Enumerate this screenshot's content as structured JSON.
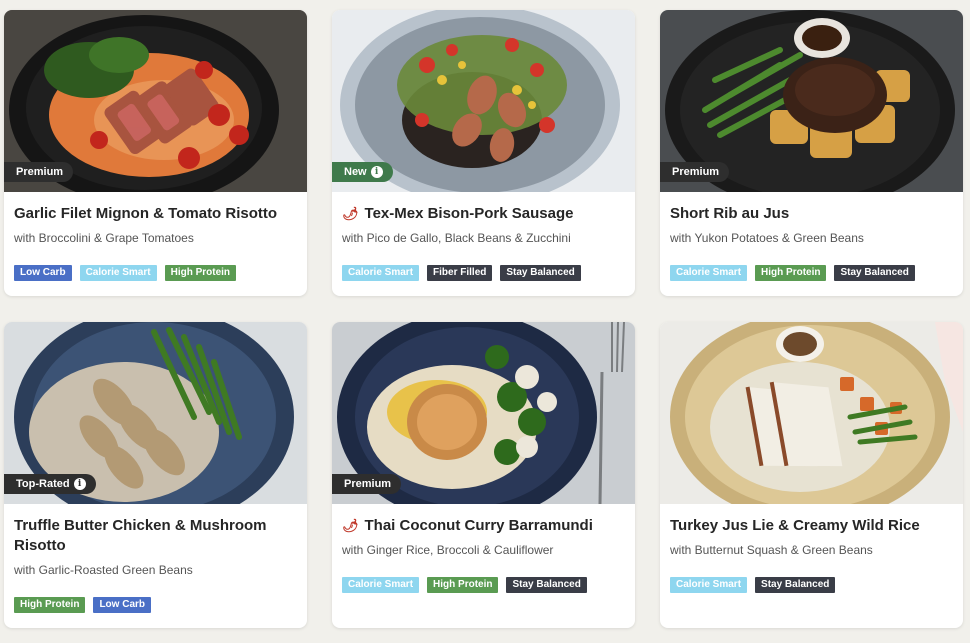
{
  "tag_colors": {
    "Low Carb": "#4a6fc6",
    "Calorie Smart": "#8ed6ef",
    "High Protein": "#5a9b52",
    "Fiber Filled": "#3a3d47",
    "Stay Balanced": "#3a3d47"
  },
  "cards": [
    {
      "badge": "Premium",
      "badge_style": "dark",
      "badge_info": false,
      "spicy": false,
      "title": "Garlic Filet Mignon & Tomato Risotto",
      "subtitle": "with Broccolini & Grape Tomatoes",
      "tags": [
        "Low Carb",
        "Calorie Smart",
        "High Protein"
      ],
      "photo": "dark-bowl-steak-risotto"
    },
    {
      "badge": "New",
      "badge_style": "green",
      "badge_info": true,
      "spicy": true,
      "title": "Tex-Mex Bison-Pork Sausage",
      "subtitle": "with Pico de Gallo, Black Beans & Zucchini",
      "tags": [
        "Calorie Smart",
        "Fiber Filled",
        "Stay Balanced"
      ],
      "photo": "grey-plate-sausage-beans"
    },
    {
      "badge": "Premium",
      "badge_style": "dark",
      "badge_info": false,
      "spicy": false,
      "title": "Short Rib au Jus",
      "subtitle": "with Yukon Potatoes & Green Beans",
      "tags": [
        "Calorie Smart",
        "High Protein",
        "Stay Balanced"
      ],
      "photo": "black-plate-short-rib"
    },
    {
      "badge": "Top-Rated",
      "badge_style": "dark",
      "badge_info": true,
      "spicy": false,
      "title": "Truffle Butter Chicken & Mushroom Risotto",
      "subtitle": "with Garlic-Roasted Green Beans",
      "tags": [
        "High Protein",
        "Low Carb"
      ],
      "photo": "blue-plate-chicken-risotto"
    },
    {
      "badge": "Premium",
      "badge_style": "dark",
      "badge_info": false,
      "spicy": true,
      "title": "Thai Coconut Curry Barramundi",
      "subtitle": "with Ginger Rice, Broccoli & Cauliflower",
      "tags": [
        "Calorie Smart",
        "High Protein",
        "Stay Balanced"
      ],
      "photo": "navy-plate-barramundi"
    },
    {
      "badge": "",
      "badge_style": "",
      "badge_info": false,
      "spicy": false,
      "title": "Turkey Jus Lie & Creamy Wild Rice",
      "subtitle": "with Butternut Squash & Green Beans",
      "tags": [
        "Calorie Smart",
        "Stay Balanced"
      ],
      "photo": "tan-plate-turkey-rice"
    }
  ]
}
